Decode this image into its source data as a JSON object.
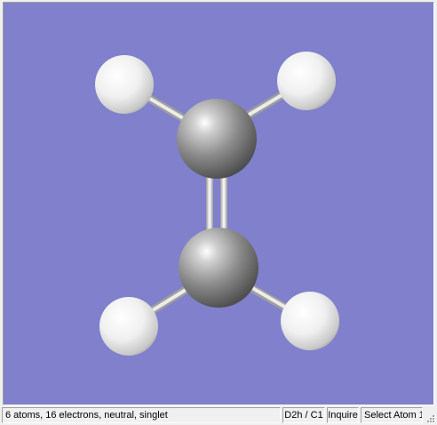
{
  "viewport": {
    "background": "#8080CC",
    "molecule": {
      "atoms": [
        {
          "element": "C",
          "label": "carbon-atom-top",
          "color": "#8a8a8a"
        },
        {
          "element": "C",
          "label": "carbon-atom-bottom",
          "color": "#8a8a8a"
        },
        {
          "element": "H",
          "label": "hydrogen-atom-top-left",
          "color": "#e6e6e6"
        },
        {
          "element": "H",
          "label": "hydrogen-atom-top-right",
          "color": "#e6e6e6"
        },
        {
          "element": "H",
          "label": "hydrogen-atom-bottom-left",
          "color": "#e6e6e6"
        },
        {
          "element": "H",
          "label": "hydrogen-atom-bottom-right",
          "color": "#e6e6e6"
        }
      ],
      "bonds": [
        {
          "type": "double",
          "between": [
            "C1",
            "C2"
          ]
        },
        {
          "type": "single",
          "between": [
            "C1",
            "H1"
          ]
        },
        {
          "type": "single",
          "between": [
            "C1",
            "H2"
          ]
        },
        {
          "type": "single",
          "between": [
            "C2",
            "H3"
          ]
        },
        {
          "type": "single",
          "between": [
            "C2",
            "H4"
          ]
        }
      ]
    }
  },
  "statusbar": {
    "info": "6 atoms, 16 electrons, neutral, singlet",
    "symmetry": "D2h / C1",
    "mode": "Inquire",
    "action": "Select Atom 1"
  }
}
